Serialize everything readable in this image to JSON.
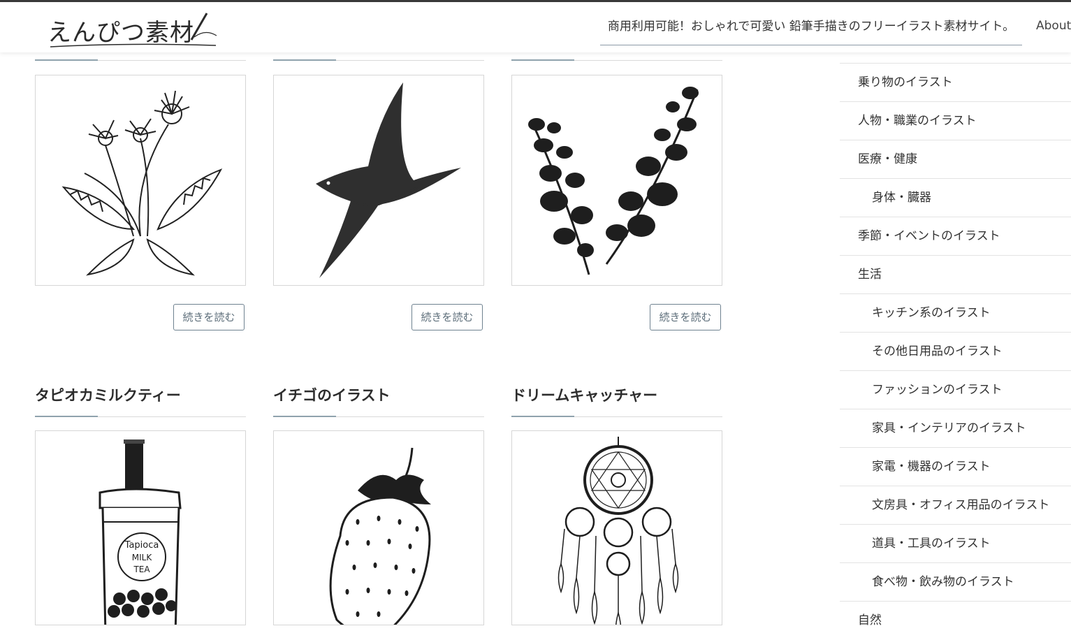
{
  "header": {
    "logo_text": "えんぴつ素材",
    "tagline": "商用利用可能！おしゃれで可愛い 鉛筆手描きのフリーイラスト素材サイト。",
    "nav_about": "About"
  },
  "posts_top": [
    {
      "image": "dandelion-illustration",
      "more": "続きを読む"
    },
    {
      "image": "swallow-illustration",
      "more": "続きを読む"
    },
    {
      "image": "eucalyptus-illustration",
      "more": "続きを読む"
    }
  ],
  "posts_bottom": [
    {
      "title": "タピオカミルクティー",
      "image": "tapioca-milk-tea-illustration",
      "cup_text_1": "Tapioca",
      "cup_text_2": "MILK",
      "cup_text_3": "TEA"
    },
    {
      "title": "イチゴのイラスト",
      "image": "strawberry-illustration"
    },
    {
      "title": "ドリームキャッチャー",
      "image": "dreamcatcher-illustration"
    }
  ],
  "sidebar": {
    "items": [
      {
        "label": "乗り物のイラスト",
        "sub": false
      },
      {
        "label": "人物・職業のイラスト",
        "sub": false
      },
      {
        "label": "医療・健康",
        "sub": false
      },
      {
        "label": "身体・臓器",
        "sub": true
      },
      {
        "label": "季節・イベントのイラスト",
        "sub": false
      },
      {
        "label": "生活",
        "sub": false
      },
      {
        "label": "キッチン系のイラスト",
        "sub": true
      },
      {
        "label": "その他日用品のイラスト",
        "sub": true
      },
      {
        "label": "ファッションのイラスト",
        "sub": true
      },
      {
        "label": "家具・インテリアのイラスト",
        "sub": true
      },
      {
        "label": "家電・機器のイラスト",
        "sub": true
      },
      {
        "label": "文房具・オフィス用品のイラスト",
        "sub": true
      },
      {
        "label": "道具・工具のイラスト",
        "sub": true
      },
      {
        "label": "食べ物・飲み物のイラスト",
        "sub": true
      },
      {
        "label": "自然",
        "sub": false
      }
    ]
  },
  "colors": {
    "accent": "#8fa2ad",
    "button_border": "#6f8290",
    "header_line": "#3a3a3a"
  }
}
